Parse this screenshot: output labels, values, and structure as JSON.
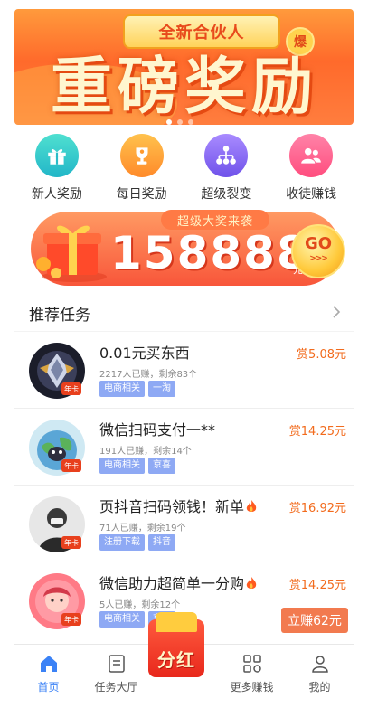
{
  "banner": {
    "pill": "全新合伙人",
    "hot": "爆",
    "headline": "重磅奖励"
  },
  "grid": [
    {
      "label": "新人奖励",
      "icon": "gift-icon",
      "color": "#2ec9c4"
    },
    {
      "label": "每日奖励",
      "icon": "trophy-icon",
      "color": "#ff9f2e"
    },
    {
      "label": "超级裂变",
      "icon": "network-icon",
      "color": "#8b6bf5"
    },
    {
      "label": "收徒赚钱",
      "icon": "users-icon",
      "color": "#ff5b8c"
    }
  ],
  "prize": {
    "tag": "超级大奖来袭",
    "amount": "158888",
    "unit": "元",
    "go": "GO",
    "go_arrows": ">>>"
  },
  "section": {
    "title": "推荐任务"
  },
  "tasks": [
    {
      "title": "0.01元买东西",
      "meta": "2217人已赚，剩余83个",
      "tags": [
        "电商相关",
        "一淘"
      ],
      "reward": "赏5.08元",
      "badge": "年卡",
      "fire": false,
      "button": ""
    },
    {
      "title": "微信扫码支付一**",
      "meta": "191人已赚，剩余14个",
      "tags": [
        "电商相关",
        "京喜"
      ],
      "reward": "赏14.25元",
      "badge": "年卡",
      "fire": false,
      "button": ""
    },
    {
      "title": "页抖音扫码领钱！新单",
      "meta": "71人已赚，剩余19个",
      "tags": [
        "注册下载",
        "抖音"
      ],
      "reward": "赏16.92元",
      "badge": "年卡",
      "fire": true,
      "button": ""
    },
    {
      "title": "微信助力超简单一分购",
      "meta": "5人已赚，剩余12个",
      "tags": [
        "电商相关",
        "京喜"
      ],
      "reward": "赏14.25元",
      "badge": "年卡",
      "fire": true,
      "button": "立赚62元"
    }
  ],
  "nav": {
    "home": "首页",
    "tasks": "任务大厅",
    "center": "分红",
    "more": "更多赚钱",
    "mine": "我的"
  },
  "colors": {
    "accent": "#3b82f6",
    "reward": "#f26b1d",
    "tag": "#8ea9f4"
  }
}
